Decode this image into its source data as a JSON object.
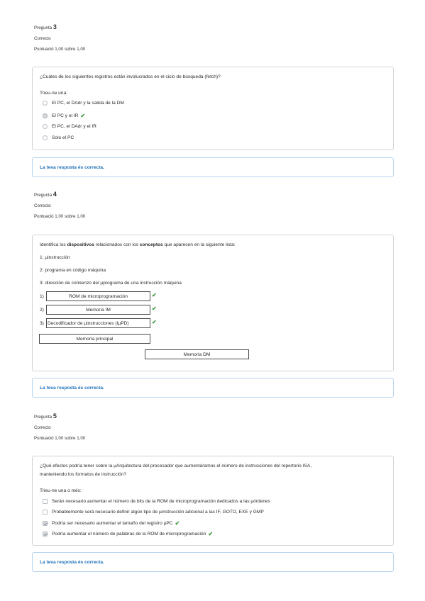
{
  "q3": {
    "label": "Pregunta",
    "number": "3",
    "status": "Correcto",
    "score": "Puntuació 1,00 sobre 1,00",
    "question": "¿Cuáles de los siguientes registros están involucrados en el ciclo de búsqueda (fetch)?",
    "prompt": "Trieu-ne una:",
    "options": [
      "El PC, el DAdr y la salida de la DM",
      "El PC y el IR",
      "El PC, el DAdr y el IR",
      "Solo el PC"
    ],
    "feedback": "La teva resposta és correcta."
  },
  "q4": {
    "label": "Pregunta",
    "number": "4",
    "status": "Correcto",
    "score": "Puntuació 1,00 sobre 1,00",
    "intro_a": "Identifica los ",
    "intro_b": "dispositivos",
    "intro_c": " relacionados con los ",
    "intro_d": "conceptos",
    "intro_e": " que aparecen en la siguiente lista:",
    "items": [
      "1: μinstrucción",
      "2: programa en código máquina",
      "3: dirección de comienzo del μprograma de una instrucción máquina"
    ],
    "answers": [
      {
        "num": "1)",
        "value": "ROM de microprogramación"
      },
      {
        "num": "2)",
        "value": "Memoria IM"
      },
      {
        "num": "3)",
        "value": "Decodificador de µinstrucciones (IµPD)"
      }
    ],
    "distractors": [
      "Memoria principal",
      "Memoria DM"
    ],
    "feedback": "La teva resposta és correcta."
  },
  "q5": {
    "label": "Pregunta",
    "number": "5",
    "status": "Correcto",
    "score": "Puntuació 1,00 sobre 1,00",
    "question_line1": "¿Qué efectos podría tener sobre la µArquitectura del procesador que aumentáramos el número de instrucciones del repertorio ISA,",
    "question_line2": "manteniendo los formatos de instrucción?",
    "prompt": "Trieu-ne una o més:",
    "options": [
      "Serán necesario aumentar el número de bits de la ROM de microprogramación dedicados a las µórdenes",
      "Probablemente será necesario definir algún tipo de µinstrucción adicional a las IF, GOTO, EXE y GMP",
      "Podría ser necesario aumentar el tamaño del registro µPC",
      "Podría aumentar el número de palabras de la ROM de microprogramación"
    ],
    "feedback": "La teva resposta és correcta."
  },
  "colors": {
    "check": "#3d9a3d",
    "feedback_text": "#1d6fb8",
    "feedback_border": "#b7d4ef",
    "box_border": "#cfd3d8"
  }
}
